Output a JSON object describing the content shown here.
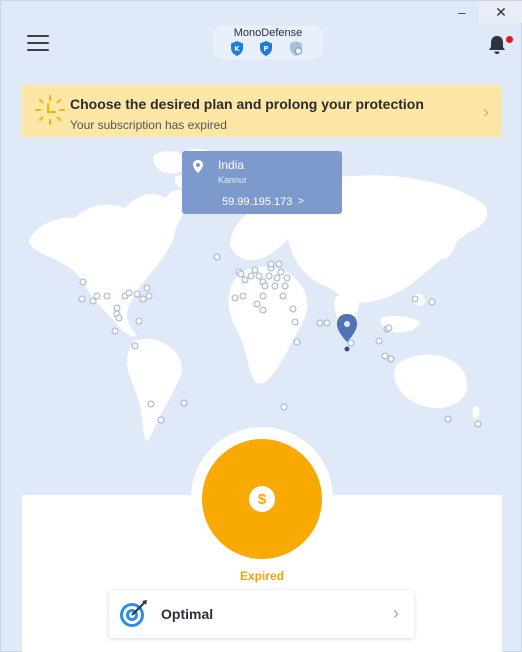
{
  "window": {
    "minimize_glyph": "–",
    "close_glyph": "✕"
  },
  "header": {
    "app_name": "MonoDefense",
    "products": [
      {
        "icon": "shield-icon",
        "color": "#1e7be0"
      },
      {
        "icon": "password-icon",
        "color": "#1e7be0"
      },
      {
        "icon": "cloud-lock-icon",
        "color": "#9fb7d6"
      }
    ],
    "notification_dot_color": "#e01c1c"
  },
  "banner": {
    "title": "Choose the desired plan and prolong your protection",
    "subtitle": "Your subscription has expired",
    "chevron": "›",
    "background": "#fde7a6",
    "icon_color": "#f9b300"
  },
  "location": {
    "country": "India",
    "city": "Kannur",
    "ip": "59.99.195.173",
    "ip_chevron": ">"
  },
  "status": {
    "label": "Expired",
    "symbol": "$",
    "color": "#f9aa02"
  },
  "plan": {
    "label": "Optimal",
    "chevron": "›",
    "icon": "target-icon"
  }
}
